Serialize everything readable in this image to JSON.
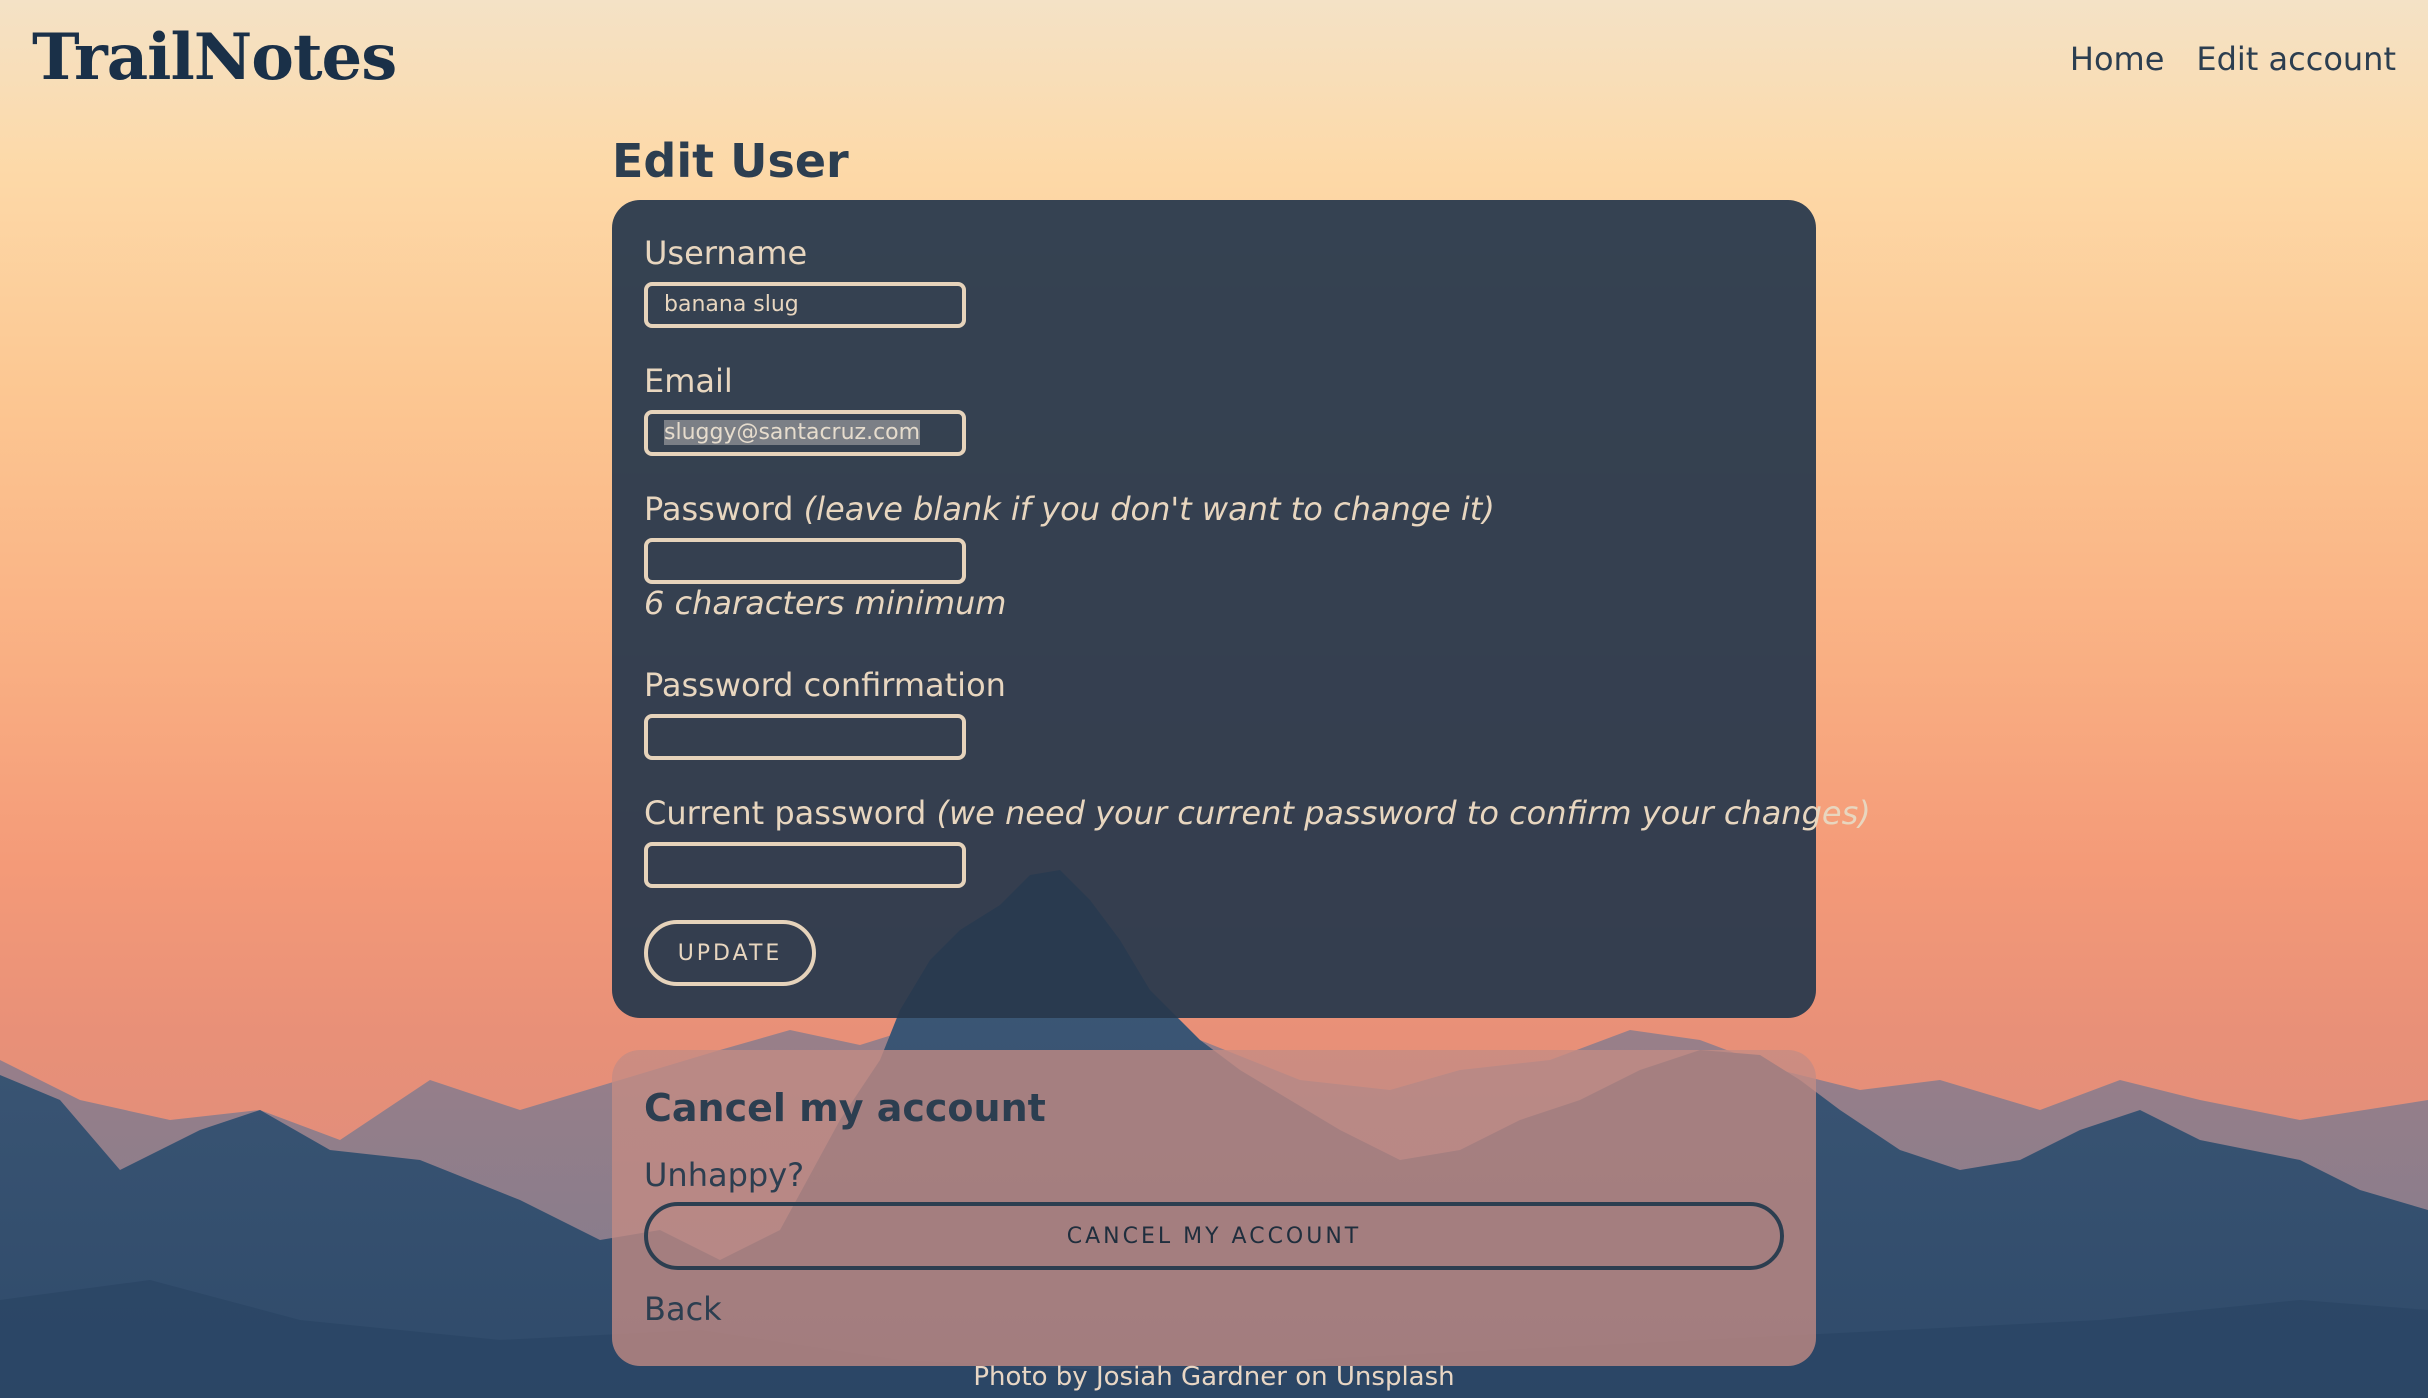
{
  "brand": {
    "logo": "TrailNotes"
  },
  "nav": {
    "home": "Home",
    "edit_account": "Edit account"
  },
  "page": {
    "title": "Edit User"
  },
  "form": {
    "username": {
      "label": "Username",
      "value": "banana slug"
    },
    "email": {
      "label": "Email",
      "value": "sluggy@santacruz.com",
      "selected": true
    },
    "password": {
      "label": "Password",
      "hint": "(leave blank if you don't want to change it)",
      "value": "",
      "helper": "6 characters minimum"
    },
    "password_confirmation": {
      "label": "Password confirmation",
      "value": ""
    },
    "current_password": {
      "label": "Current password",
      "hint": "(we need your current password to confirm your changes)",
      "value": ""
    },
    "submit_label": "UPDATE"
  },
  "cancel_section": {
    "title": "Cancel my account",
    "prompt": "Unhappy?",
    "button_label": "CANCEL MY ACCOUNT",
    "back_label": "Back"
  },
  "footer": {
    "photo_by": "Photo by",
    "photographer": "Josiah Gardner",
    "on": "on",
    "source": "Unsplash"
  },
  "colors": {
    "navy": "#2c3e50",
    "card": "#28384c",
    "cream": "#e8d6bf",
    "sky_top": "#f4e2c6",
    "sky_bottom": "#f49a78"
  }
}
